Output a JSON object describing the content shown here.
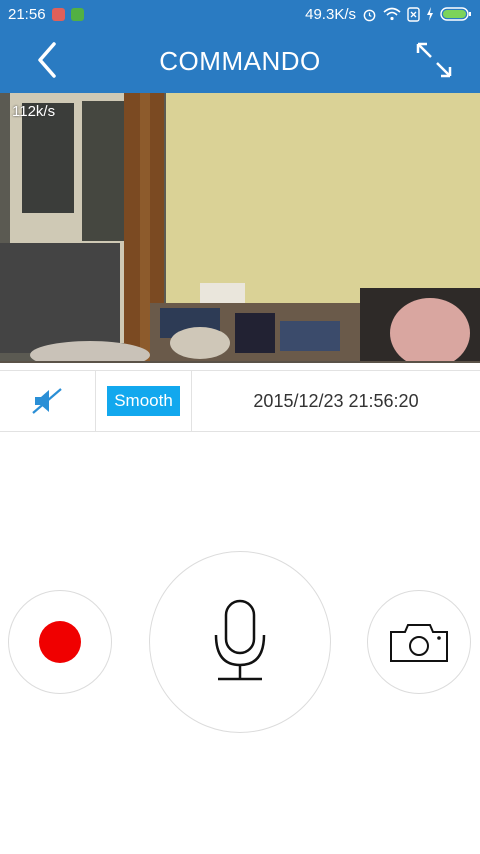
{
  "status_bar": {
    "time": "21:56",
    "network_speed": "49.3K/s"
  },
  "header": {
    "title": "COMMANDO"
  },
  "video": {
    "bitrate": "112k/s"
  },
  "controls": {
    "quality_label": "Smooth",
    "datetime": "2015/12/23 21:56:20"
  },
  "colors": {
    "primary": "#2a7bc2",
    "accent": "#12a8ee",
    "record": "#f00000"
  },
  "icons": {
    "back": "chevron-left",
    "fullscreen": "expand-arrows",
    "mute": "speaker-muted",
    "record": "red-dot",
    "mic": "microphone",
    "camera": "camera"
  }
}
